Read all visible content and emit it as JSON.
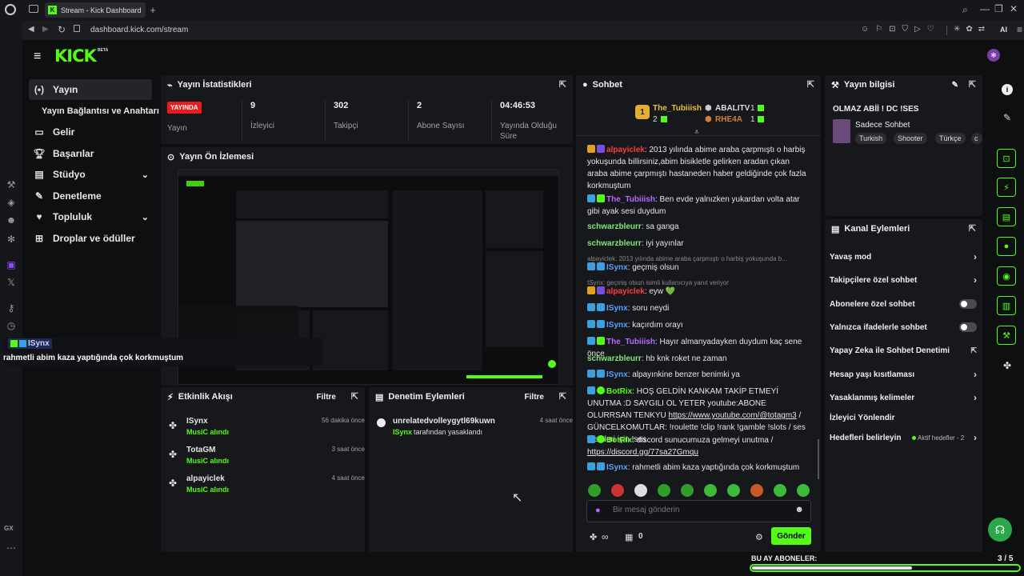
{
  "browser": {
    "tab_title": "Stream - Kick Dashboard",
    "url": "dashboard.kick.com/stream",
    "ai_label": "AI",
    "gx_label": "GX"
  },
  "app": {
    "logo": "KICK",
    "logo_beta": "BETA"
  },
  "sidebar": {
    "items": [
      {
        "label": "Yayın",
        "icon": "broadcast-icon"
      },
      {
        "label": "Yayın Bağlantısı ve Anahtarı"
      },
      {
        "label": "Gelir",
        "icon": "money-icon"
      },
      {
        "label": "Başarılar",
        "icon": "trophy-icon"
      },
      {
        "label": "Stüdyo",
        "icon": "studio-icon"
      },
      {
        "label": "Denetleme",
        "icon": "wrench-icon"
      },
      {
        "label": "Topluluk",
        "icon": "community-icon"
      },
      {
        "label": "Droplar ve ödüller",
        "icon": "drops-icon"
      }
    ]
  },
  "stats": {
    "title": "Yayın İstatistikleri",
    "live_badge": "YAYINDA",
    "live_label": "Yayın",
    "viewers_value": "9",
    "viewers_label": "İzleyici",
    "followers_value": "302",
    "followers_label": "Takipçi",
    "subs_value": "2",
    "subs_label": "Abone Sayısı",
    "duration_value": "04:46:53",
    "duration_label": "Yayında Olduğu Süre"
  },
  "preview": {
    "title": "Yayın Ön İzlemesi"
  },
  "overlay": {
    "user": "ISynx",
    "message": "rahmetli abim kaza yaptığında çok korkmuştum"
  },
  "activity": {
    "title": "Etkinlik Akışı",
    "filter": "Filtre",
    "items": [
      {
        "user": "ISynx",
        "detail": "MusiC alındı",
        "time": "56 dakika önce"
      },
      {
        "user": "TotaGM",
        "detail": "MusiC alındı",
        "time": "3 saat önce"
      },
      {
        "user": "alpayiclek",
        "detail": "MusiC alındı",
        "time": "4 saat önce"
      }
    ]
  },
  "moderation": {
    "title": "Denetim Eylemleri",
    "filter": "Filtre",
    "items": [
      {
        "user": "unrelatedvolleygytl69kuwn",
        "by": "ISynx",
        "action": "tarafından yasaklandı",
        "time": "4 saat önce"
      }
    ]
  },
  "chat": {
    "title": "Sohbet",
    "leader_rank": "1",
    "leader_name": "The_Tubiiish",
    "leader_count": "2",
    "second_name": "ABALITV",
    "second_count": "1",
    "third_name": "RHE4A",
    "third_count": "1",
    "messages": [
      {
        "user": "alpayiclek",
        "text": "2013 yılında abime araba çarpmıştı o harbiş yokuşunda billirsiniz,abim bisikletle gelirken aradan çıkan araba abime çarpmıştı hastaneden haber geldiğinde çok fazla korkmuştum"
      },
      {
        "user": "The_Tubiiish",
        "text": "Ben evde yalnızken yukardan volta atar gibi ayak sesi duydum"
      },
      {
        "user": "schwarzbleurr",
        "text": "sa ganga"
      },
      {
        "user": "schwarzbleurr",
        "text": "iyi yayınlar"
      },
      {
        "reply": "alpayiclek: 2013 yılında abime araba çarpmıştı o harbiş yokuşunda b...",
        "user": "ISynx",
        "text": "geçmiş olsun"
      },
      {
        "reply": "ISynx: geçmiş olsun isimli kullanıcıya yanıt veriyor",
        "user": "alpayiclek",
        "text": "eyw 💚"
      },
      {
        "user": "ISynx",
        "text": "soru neydi"
      },
      {
        "user": "ISynx",
        "text": "kaçırdım orayı"
      },
      {
        "user": "The_Tubiiish",
        "text": "Hayır almanyadayken duydum kaç sene önce"
      },
      {
        "user": "schwarzbleurr",
        "text": "hb knk roket ne zaman"
      },
      {
        "user": "ISynx",
        "text": "alpayınkine benzer benimki ya"
      },
      {
        "user": "BotRix",
        "text": "HOŞ GELDİN KANKAM TAKİP ETMEYİ UNUTMA :D SAYGILI OL YETER youtube:ABONE OLURRSAN TENKYU",
        "link": "https://www.youtube.com/@totagm3",
        "after": " / GÜNCELKOMUTLAR: !roulette !clip !rank !gamble !slots / ses efektleri için !ses"
      },
      {
        "user": "BotRix",
        "text": "discord sunucumuza gelmeyi unutma /",
        "link": "https://discord.gg/77sa27Gmqu"
      },
      {
        "user": "ISynx",
        "text": "rahmetli abim kaza yaptığında çok korkmuştum"
      }
    ],
    "input_placeholder": "Bir mesaj gönderin",
    "points": "∞",
    "gift_count": "0",
    "send_label": "Gönder"
  },
  "stream_info": {
    "title": "Yayın bilgisi",
    "stream_title": "OLMAZ ABİİ ! DC !SES",
    "category": "Sadece Sohbet",
    "tags": [
      "Turkish",
      "Shooter",
      "Türkçe",
      "c"
    ]
  },
  "channel_actions": {
    "title": "Kanal Eylemleri",
    "items": [
      {
        "label": "Yavaş mod",
        "control": "chevron"
      },
      {
        "label": "Takipçilere özel sohbet",
        "control": "chevron"
      },
      {
        "label": "Abonelere özel sohbet",
        "control": "toggle"
      },
      {
        "label": "Yalnızca ifadelerle sohbet",
        "control": "toggle"
      },
      {
        "label": "Yapay Zeka ile Sohbet Denetimi",
        "control": "external"
      },
      {
        "label": "Hesap yaşı kısıtlaması",
        "control": "chevron"
      },
      {
        "label": "Yasaklanmış kelimeler",
        "control": "chevron"
      },
      {
        "label": "İzleyici Yönlendir",
        "control": "none"
      },
      {
        "label": "Hedefleri belirleyin",
        "control": "chevron",
        "extra": "Aktif hedefler - 2"
      }
    ]
  },
  "goal": {
    "label": "BU AY ABONELER:",
    "current": 3,
    "target": 5,
    "progress_text": "3 / 5"
  },
  "colors": {
    "accent": "#53fc18",
    "live": "#e81c1c",
    "panel": "#17181b"
  }
}
